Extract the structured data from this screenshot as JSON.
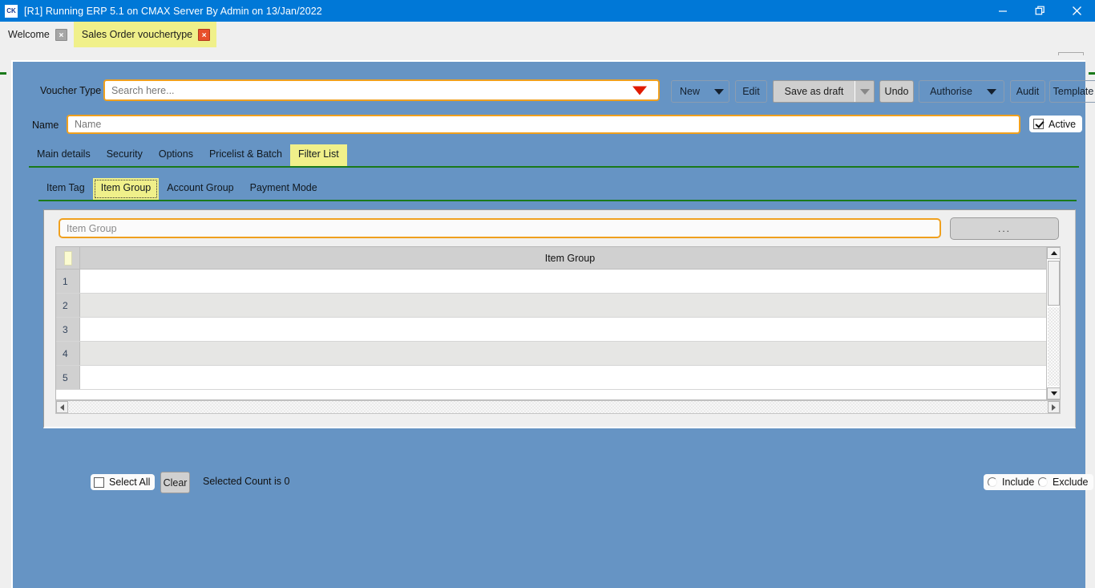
{
  "window": {
    "icon": "app-icon",
    "title": "[R1] Running ERP 5.1 on CMAX Server By Admin on 13/Jan/2022",
    "icon_text": "CK",
    "controls": {
      "minimize": "minimize-icon",
      "maximize": "restore-icon",
      "close": "close-icon"
    }
  },
  "tabstrip": {
    "tabs": [
      {
        "label": "Welcome",
        "close": "×",
        "active": false
      },
      {
        "label": "Sales Order vouchertype",
        "close": "×",
        "active": true
      }
    ],
    "new_tab": "+"
  },
  "form": {
    "voucher_type_label": "Voucher Type",
    "voucher_type_placeholder": "Search here...",
    "name_label": "Name",
    "name_placeholder": "Name",
    "active_label": "Active",
    "toolbar": {
      "new": "New",
      "edit": "Edit",
      "save_as_draft": "Save as draft",
      "undo": "Undo",
      "authorise": "Authorise",
      "audit": "Audit",
      "template": "Template"
    },
    "tabs_primary": [
      {
        "label": "Main details",
        "selected": false
      },
      {
        "label": "Security",
        "selected": false
      },
      {
        "label": "Options",
        "selected": false
      },
      {
        "label": "Pricelist & Batch",
        "selected": false
      },
      {
        "label": "Filter List",
        "selected": true
      }
    ],
    "tabs_secondary": [
      {
        "label": "Item Tag",
        "selected": false
      },
      {
        "label": "Item Group",
        "selected": true
      },
      {
        "label": "Account Group",
        "selected": false
      },
      {
        "label": "Payment Mode",
        "selected": false
      }
    ]
  },
  "panel": {
    "filter_placeholder": "Item Group",
    "browse_label": "...",
    "grid": {
      "column_header": "Item Group",
      "rows": [
        {
          "no": "1",
          "value": ""
        },
        {
          "no": "2",
          "value": ""
        },
        {
          "no": "3",
          "value": ""
        },
        {
          "no": "4",
          "value": ""
        },
        {
          "no": "5",
          "value": ""
        }
      ]
    },
    "footer": {
      "select_all_label": "Select All",
      "clear_label": "Clear",
      "selected_count": "Selected Count is 0",
      "include_label": "Include",
      "exclude_label": "Exclude"
    }
  },
  "colors": {
    "titlebar": "#0078d7",
    "form_blue": "#6694c4",
    "accent_orange": "#f0a01e",
    "tab_highlight": "#f0f08a",
    "rule_green": "#1a7a1a",
    "close_red": "#e8502a"
  }
}
